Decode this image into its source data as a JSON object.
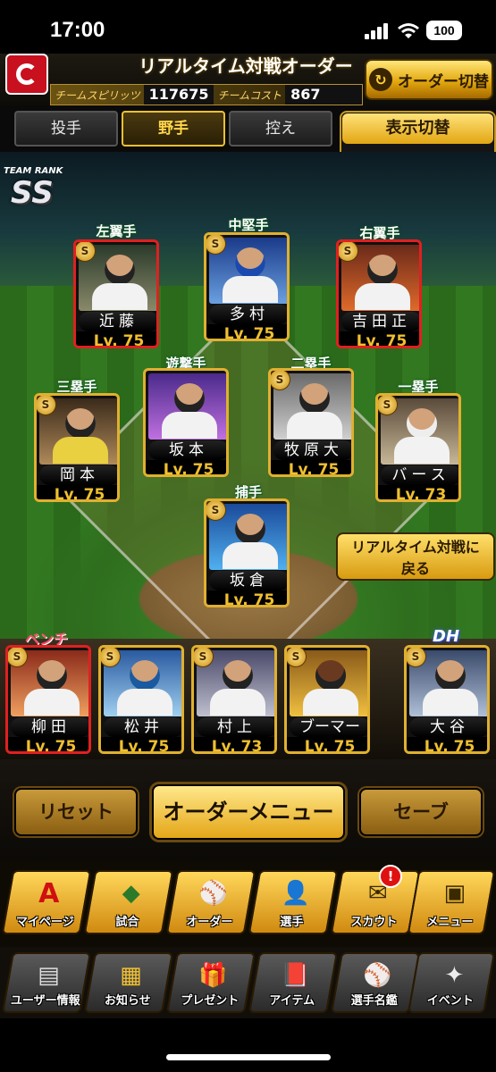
{
  "status_bar": {
    "time": "17:00",
    "battery": "100"
  },
  "header": {
    "title": "リアルタイム対戦オーダー",
    "team_spirits_label": "チームスピリッツ",
    "team_spirits_value": "117675",
    "team_cost_label": "チームコスト",
    "team_cost_value": "867",
    "order_switch_label": "オーダー切替"
  },
  "tabs": [
    {
      "label": "投手",
      "active": false
    },
    {
      "label": "野手",
      "active": true
    },
    {
      "label": "控え",
      "active": false
    }
  ],
  "display_toggle": {
    "label": "表示切替",
    "value": "ー"
  },
  "team_rank": {
    "label": "TEAM RANK",
    "value": "SS"
  },
  "field_players": [
    {
      "position": "左翼手",
      "name": "近藤",
      "level": "Lv. 75"
    },
    {
      "position": "中堅手",
      "name": "多村",
      "level": "Lv. 75"
    },
    {
      "position": "右翼手",
      "name": "吉田正",
      "level": "Lv. 75"
    },
    {
      "position": "遊撃手",
      "name": "坂本",
      "level": "Lv. 75"
    },
    {
      "position": "二塁手",
      "name": "牧原大",
      "level": "Lv. 75"
    },
    {
      "position": "三塁手",
      "name": "岡本",
      "level": "Lv. 75"
    },
    {
      "position": "一塁手",
      "name": "バース",
      "level": "Lv. 73"
    },
    {
      "position": "捕手",
      "name": "坂倉",
      "level": "Lv. 75"
    }
  ],
  "back_button": {
    "line1": "リアルタイム対戦に",
    "line2": "戻る"
  },
  "bench": {
    "label": "ベンチ",
    "dh_label": "DH",
    "players": [
      {
        "name": "柳田",
        "level": "Lv. 75"
      },
      {
        "name": "松井",
        "level": "Lv. 75"
      },
      {
        "name": "村上",
        "level": "Lv. 73"
      },
      {
        "name": "ブーマー",
        "level": "Lv. 75"
      },
      {
        "name": "大谷",
        "level": "Lv. 75"
      }
    ]
  },
  "order_buttons": {
    "reset": "リセット",
    "menu": "オーダーメニュー",
    "save": "セーブ"
  },
  "nav_row1": [
    {
      "label": "マイページ",
      "icon": "A"
    },
    {
      "label": "試合",
      "icon": "◆"
    },
    {
      "label": "オーダー",
      "icon": "⚾"
    },
    {
      "label": "選手",
      "icon": "👤"
    },
    {
      "label": "スカウト",
      "icon": "✉"
    },
    {
      "label": "メニュー",
      "icon": "▣"
    }
  ],
  "scout_badge": "!",
  "nav_row2": [
    {
      "label": "ユーザー情報",
      "icon": "▤"
    },
    {
      "label": "お知らせ",
      "icon": "▦"
    },
    {
      "label": "プレゼント",
      "icon": "🎁"
    },
    {
      "label": "アイテム",
      "icon": "📕"
    },
    {
      "label": "選手名鑑",
      "icon": "⚾"
    },
    {
      "label": "イベント",
      "icon": "✦"
    }
  ],
  "colors": {
    "accent_gold": "#e0b030",
    "team_red": "#c8101e",
    "level_text": "#f0c030"
  }
}
